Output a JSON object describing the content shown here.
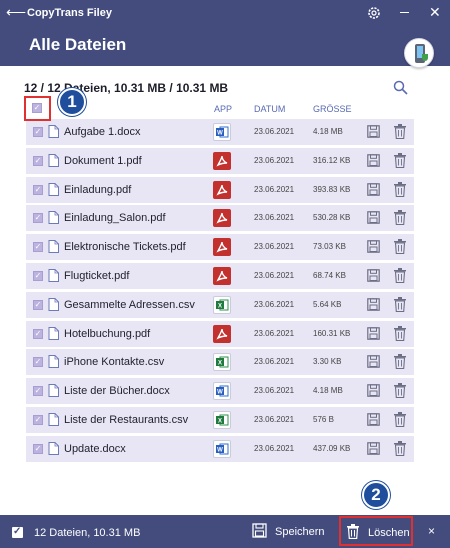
{
  "app": {
    "title": "CopyTrans Filey",
    "back_glyph": "⟵",
    "close_glyph": "✕"
  },
  "header": {
    "title": "Alle Dateien"
  },
  "summary": {
    "text": "12 / 12 Dateien, 10.31 MB / 10.31 MB"
  },
  "columns": {
    "app": "APP",
    "date": "DATUM",
    "size": "GRÖSSE"
  },
  "callouts": {
    "one": "1",
    "two": "2"
  },
  "files": [
    {
      "name": "Aufgabe 1.docx",
      "app": "word",
      "date": "23.06.2021",
      "size": "4.18 MB"
    },
    {
      "name": "Dokument 1.pdf",
      "app": "pdf",
      "date": "23.06.2021",
      "size": "316.12 KB"
    },
    {
      "name": "Einladung.pdf",
      "app": "pdf",
      "date": "23.06.2021",
      "size": "393.83 KB"
    },
    {
      "name": "Einladung_Salon.pdf",
      "app": "pdf",
      "date": "23.06.2021",
      "size": "530.28 KB"
    },
    {
      "name": "Elektronische Tickets.pdf",
      "app": "pdf",
      "date": "23.06.2021",
      "size": "73.03 KB"
    },
    {
      "name": "Flugticket.pdf",
      "app": "pdf",
      "date": "23.06.2021",
      "size": "68.74 KB"
    },
    {
      "name": "Gesammelte Adressen.csv",
      "app": "excel",
      "date": "23.06.2021",
      "size": "5.64 KB"
    },
    {
      "name": "Hotelbuchung.pdf",
      "app": "pdf",
      "date": "23.06.2021",
      "size": "160.31 KB"
    },
    {
      "name": "iPhone Kontakte.csv",
      "app": "excel",
      "date": "23.06.2021",
      "size": "3.30 KB"
    },
    {
      "name": "Liste der Bücher.docx",
      "app": "word",
      "date": "23.06.2021",
      "size": "4.18 MB"
    },
    {
      "name": "Liste der Restaurants.csv",
      "app": "excel",
      "date": "23.06.2021",
      "size": "576 B"
    },
    {
      "name": "Update.docx",
      "app": "word",
      "date": "23.06.2021",
      "size": "437.09 KB"
    }
  ],
  "bottombar": {
    "selection": "12 Dateien, 10.31 MB",
    "save_label": "Speichern",
    "delete_label": "Löschen",
    "close_glyph": "×"
  },
  "colors": {
    "brand": "#434c7d",
    "row_bg": "#e8e6f4",
    "highlight": "#e03030",
    "callout": "#1f4f9c"
  }
}
